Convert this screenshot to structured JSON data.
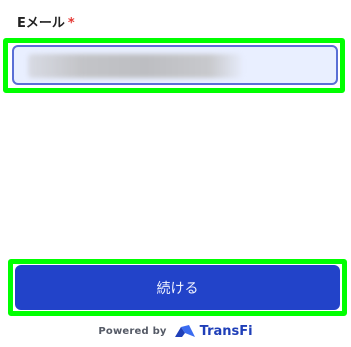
{
  "form": {
    "email_label": "Eメール",
    "required_marker": "*",
    "email_value": "",
    "email_placeholder": ""
  },
  "continue_button": {
    "label": "続ける"
  },
  "footer": {
    "powered_by": "Powered by",
    "brand_name": "TransFi"
  },
  "colors": {
    "primary": "#2243c9",
    "input_background": "#e9efff",
    "input_border": "#5a6fd6",
    "required": "#e53935",
    "highlight": "#00ff00"
  },
  "icons": {
    "brand_logo": "transfi-logo-icon"
  }
}
